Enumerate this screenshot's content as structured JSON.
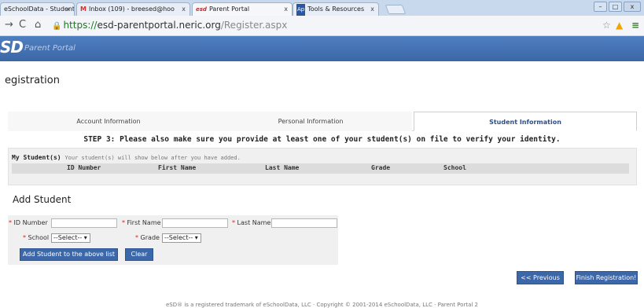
{
  "browser": {
    "tabs": [
      {
        "label": "eSchoolData - Student Profile",
        "favicon": "",
        "active": false
      },
      {
        "label": "Inbox (109) - breesed@hoo",
        "favicon": "M",
        "active": false
      },
      {
        "label": "Parent Portal",
        "favicon": "esd",
        "active": true
      },
      {
        "label": "Tools & Resources",
        "favicon": "Ap",
        "active": false
      }
    ],
    "url": {
      "scheme": "https://",
      "host": "esd-parentportal.neric.org",
      "path": "/Register.aspx"
    },
    "icons": [
      "star-icon",
      "drive-icon",
      "menu-icon"
    ]
  },
  "header": {
    "logo": "SD",
    "portal_name": "Parent Portal",
    "color": "#3b67a6"
  },
  "page": {
    "title": "egistration"
  },
  "steps": [
    {
      "label": "Account Information",
      "active": false
    },
    {
      "label": "Personal Information",
      "active": false
    },
    {
      "label": "Student Information",
      "active": true
    }
  ],
  "instruction": "STEP 3: Please also make sure you provide at least one of your student(s) on file to verify your identity.",
  "my_students": {
    "title": "My Student(s)",
    "subtitle": "Your student(s) will show below after you have added.",
    "columns": [
      "ID Number",
      "First Name",
      "Last Name",
      "Grade",
      "School"
    ]
  },
  "add_student": {
    "title": "Add Student",
    "required_mark": "*",
    "id_label": "ID Number",
    "first_name_label": "First Name",
    "last_name_label": "Last Name",
    "school_label": "School",
    "school_value": "--Select--",
    "grade_label": "Grade",
    "grade_value": "--Select--",
    "add_button": "Add Student to the above list",
    "clear_button": "Clear"
  },
  "navigation": {
    "previous": "<< Previous",
    "finish": "Finish Registration!"
  },
  "footer": "eSD® is a registered trademark of eSchoolData, LLC · Copyright © 2001-2014 eSchoolData, LLC · Parent Portal 2"
}
